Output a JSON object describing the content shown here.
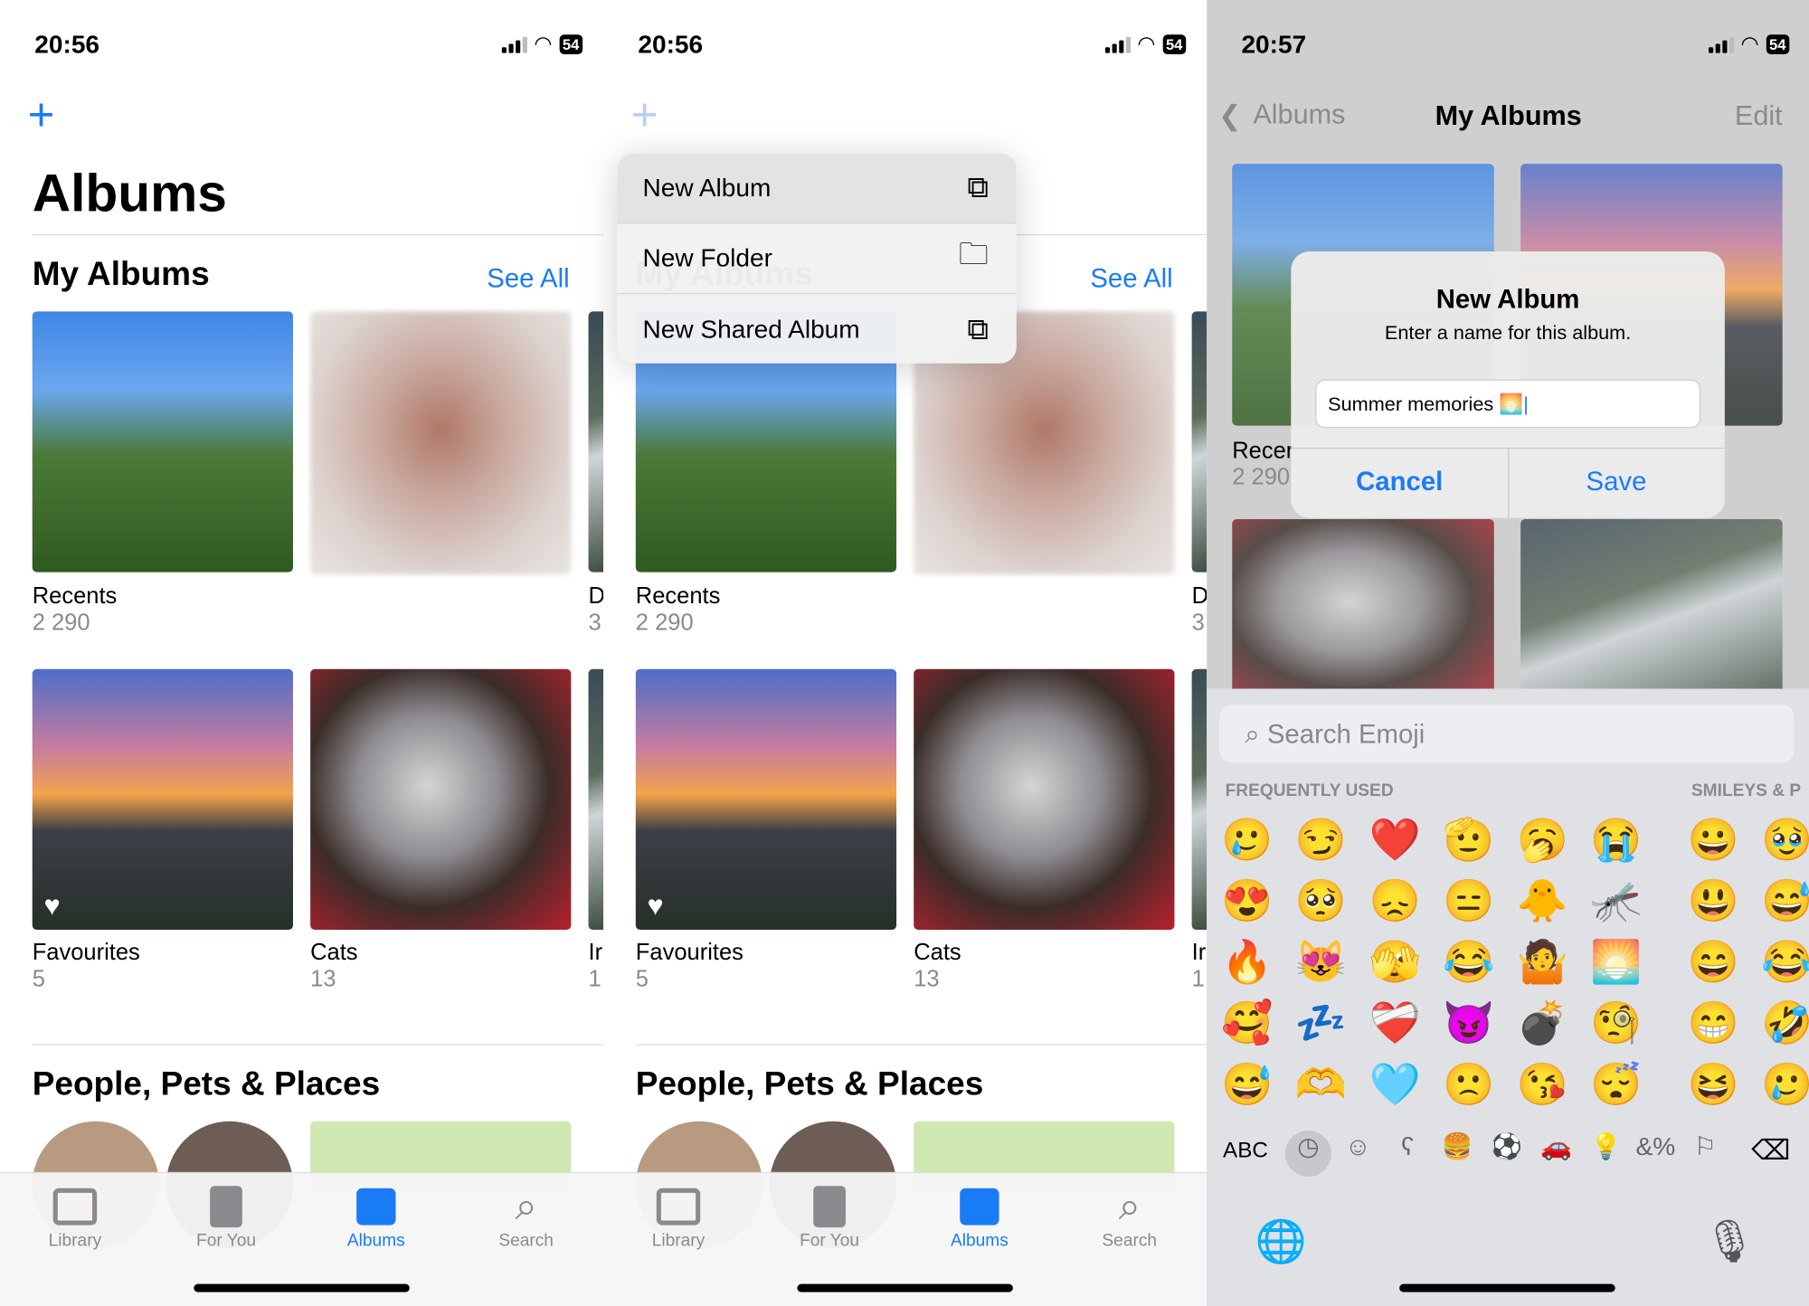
{
  "screens": {
    "albums": {
      "time": "20:56",
      "battery": "54",
      "title": "Albums",
      "my_albums": "My Albums",
      "see_all": "See All",
      "albums": [
        {
          "name": "Recents",
          "count": "2 290"
        },
        {
          "name": "D",
          "count": "3"
        },
        {
          "name": "Favourites",
          "count": "5"
        },
        {
          "name": "Cats",
          "count": "13"
        },
        {
          "name": "Ir",
          "count": "1"
        }
      ],
      "people_section": "People, Pets & Places",
      "tabs": [
        {
          "label": "Library",
          "icon": "photo-stack-icon"
        },
        {
          "label": "For You",
          "icon": "for-you-icon"
        },
        {
          "label": "Albums",
          "icon": "albums-icon",
          "active": true
        },
        {
          "label": "Search",
          "icon": "search-icon"
        }
      ]
    },
    "menu": [
      {
        "label": "New Album",
        "icon": "new-album-icon"
      },
      {
        "label": "New Folder",
        "icon": "new-folder-icon"
      },
      {
        "label": "New Shared Album",
        "icon": "shared-album-icon"
      }
    ],
    "my_albums_screen": {
      "time": "20:57",
      "battery": "54",
      "back": "Albums",
      "title": "My Albums",
      "edit": "Edit",
      "partial_album": {
        "name": "Recer",
        "count": "2 290"
      },
      "dialog": {
        "title": "New Album",
        "message": "Enter a name for this album.",
        "input_value": "Summer memories 🌅",
        "cancel": "Cancel",
        "save": "Save"
      },
      "keyboard": {
        "search_placeholder": "Search Emoji",
        "section_frequent": "FREQUENTLY USED",
        "section_smileys": "SMILEYS & P",
        "frequent": [
          [
            "🥲",
            "😏",
            "❤️",
            "🫡",
            "🥱",
            "😭"
          ],
          [
            "😍",
            "🥺",
            "😞",
            "😑",
            "🐥",
            "🦟"
          ],
          [
            "🔥",
            "😻",
            "🫣",
            "😂",
            "🤷",
            "🌅"
          ],
          [
            "🥰",
            "💤",
            "❤️‍🩹",
            "😈",
            "💣",
            "🧐"
          ],
          [
            "😅",
            "🫶",
            "🩵",
            "🙁",
            "😘",
            "😴"
          ]
        ],
        "smileys": [
          [
            "😀",
            "🥹"
          ],
          [
            "😃",
            "😅"
          ],
          [
            "😄",
            "😂"
          ],
          [
            "😁",
            "🤣"
          ],
          [
            "😆",
            "🥲"
          ]
        ],
        "abc": "ABC",
        "categories": [
          "clock-icon",
          "smiley-icon",
          "bear-icon",
          "food-icon",
          "ball-icon",
          "car-icon",
          "bulb-icon",
          "symbols-icon",
          "flag-icon"
        ],
        "category_glyphs": [
          "◷",
          "☺",
          "ʕ",
          "🍔",
          "⚽",
          "🚗",
          "💡",
          "&%",
          "⚐"
        ]
      }
    }
  },
  "colors": {
    "accent": "#1a7cf5"
  }
}
